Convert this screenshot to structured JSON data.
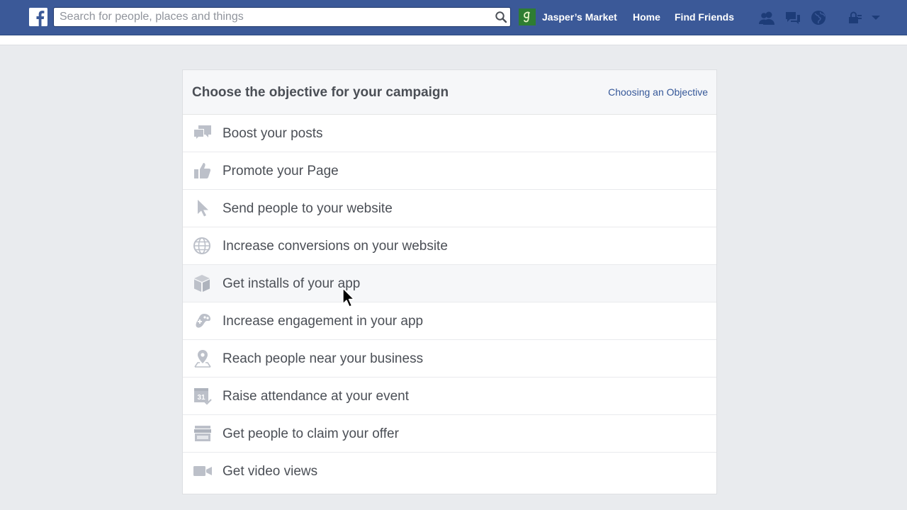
{
  "topbar": {
    "search_placeholder": "Search for people, places and things",
    "page_name": "Jasper’s Market",
    "home_label": "Home",
    "find_friends_label": "Find Friends",
    "icons": [
      "facebook-logo-icon",
      "search-icon",
      "friend-requests-icon",
      "messages-icon",
      "notifications-globe-icon",
      "privacy-lock-icon",
      "account-menu-chevron-icon"
    ]
  },
  "panel": {
    "title": "Choose the objective for your campaign",
    "help_link": "Choosing an Objective",
    "objectives": [
      {
        "label": "Boost your posts",
        "icon": "speech-bubbles-icon"
      },
      {
        "label": "Promote your Page",
        "icon": "thumbs-up-icon"
      },
      {
        "label": "Send people to your website",
        "icon": "pointer-arrow-icon"
      },
      {
        "label": "Increase conversions on your website",
        "icon": "globe-icon"
      },
      {
        "label": "Get installs of your app",
        "icon": "app-box-icon"
      },
      {
        "label": "Increase engagement in your app",
        "icon": "gamepad-icon"
      },
      {
        "label": "Reach people near your business",
        "icon": "map-pin-icon"
      },
      {
        "label": "Raise attendance at your event",
        "icon": "calendar-icon"
      },
      {
        "label": "Get people to claim your offer",
        "icon": "storefront-icon"
      },
      {
        "label": "Get video views",
        "icon": "video-camera-icon"
      }
    ]
  },
  "colors": {
    "header_blue": "#3b5998",
    "page_bg": "#e9ebee",
    "icon_gray": "#bcc0c9",
    "text": "#4b4f56",
    "link": "#365899"
  }
}
